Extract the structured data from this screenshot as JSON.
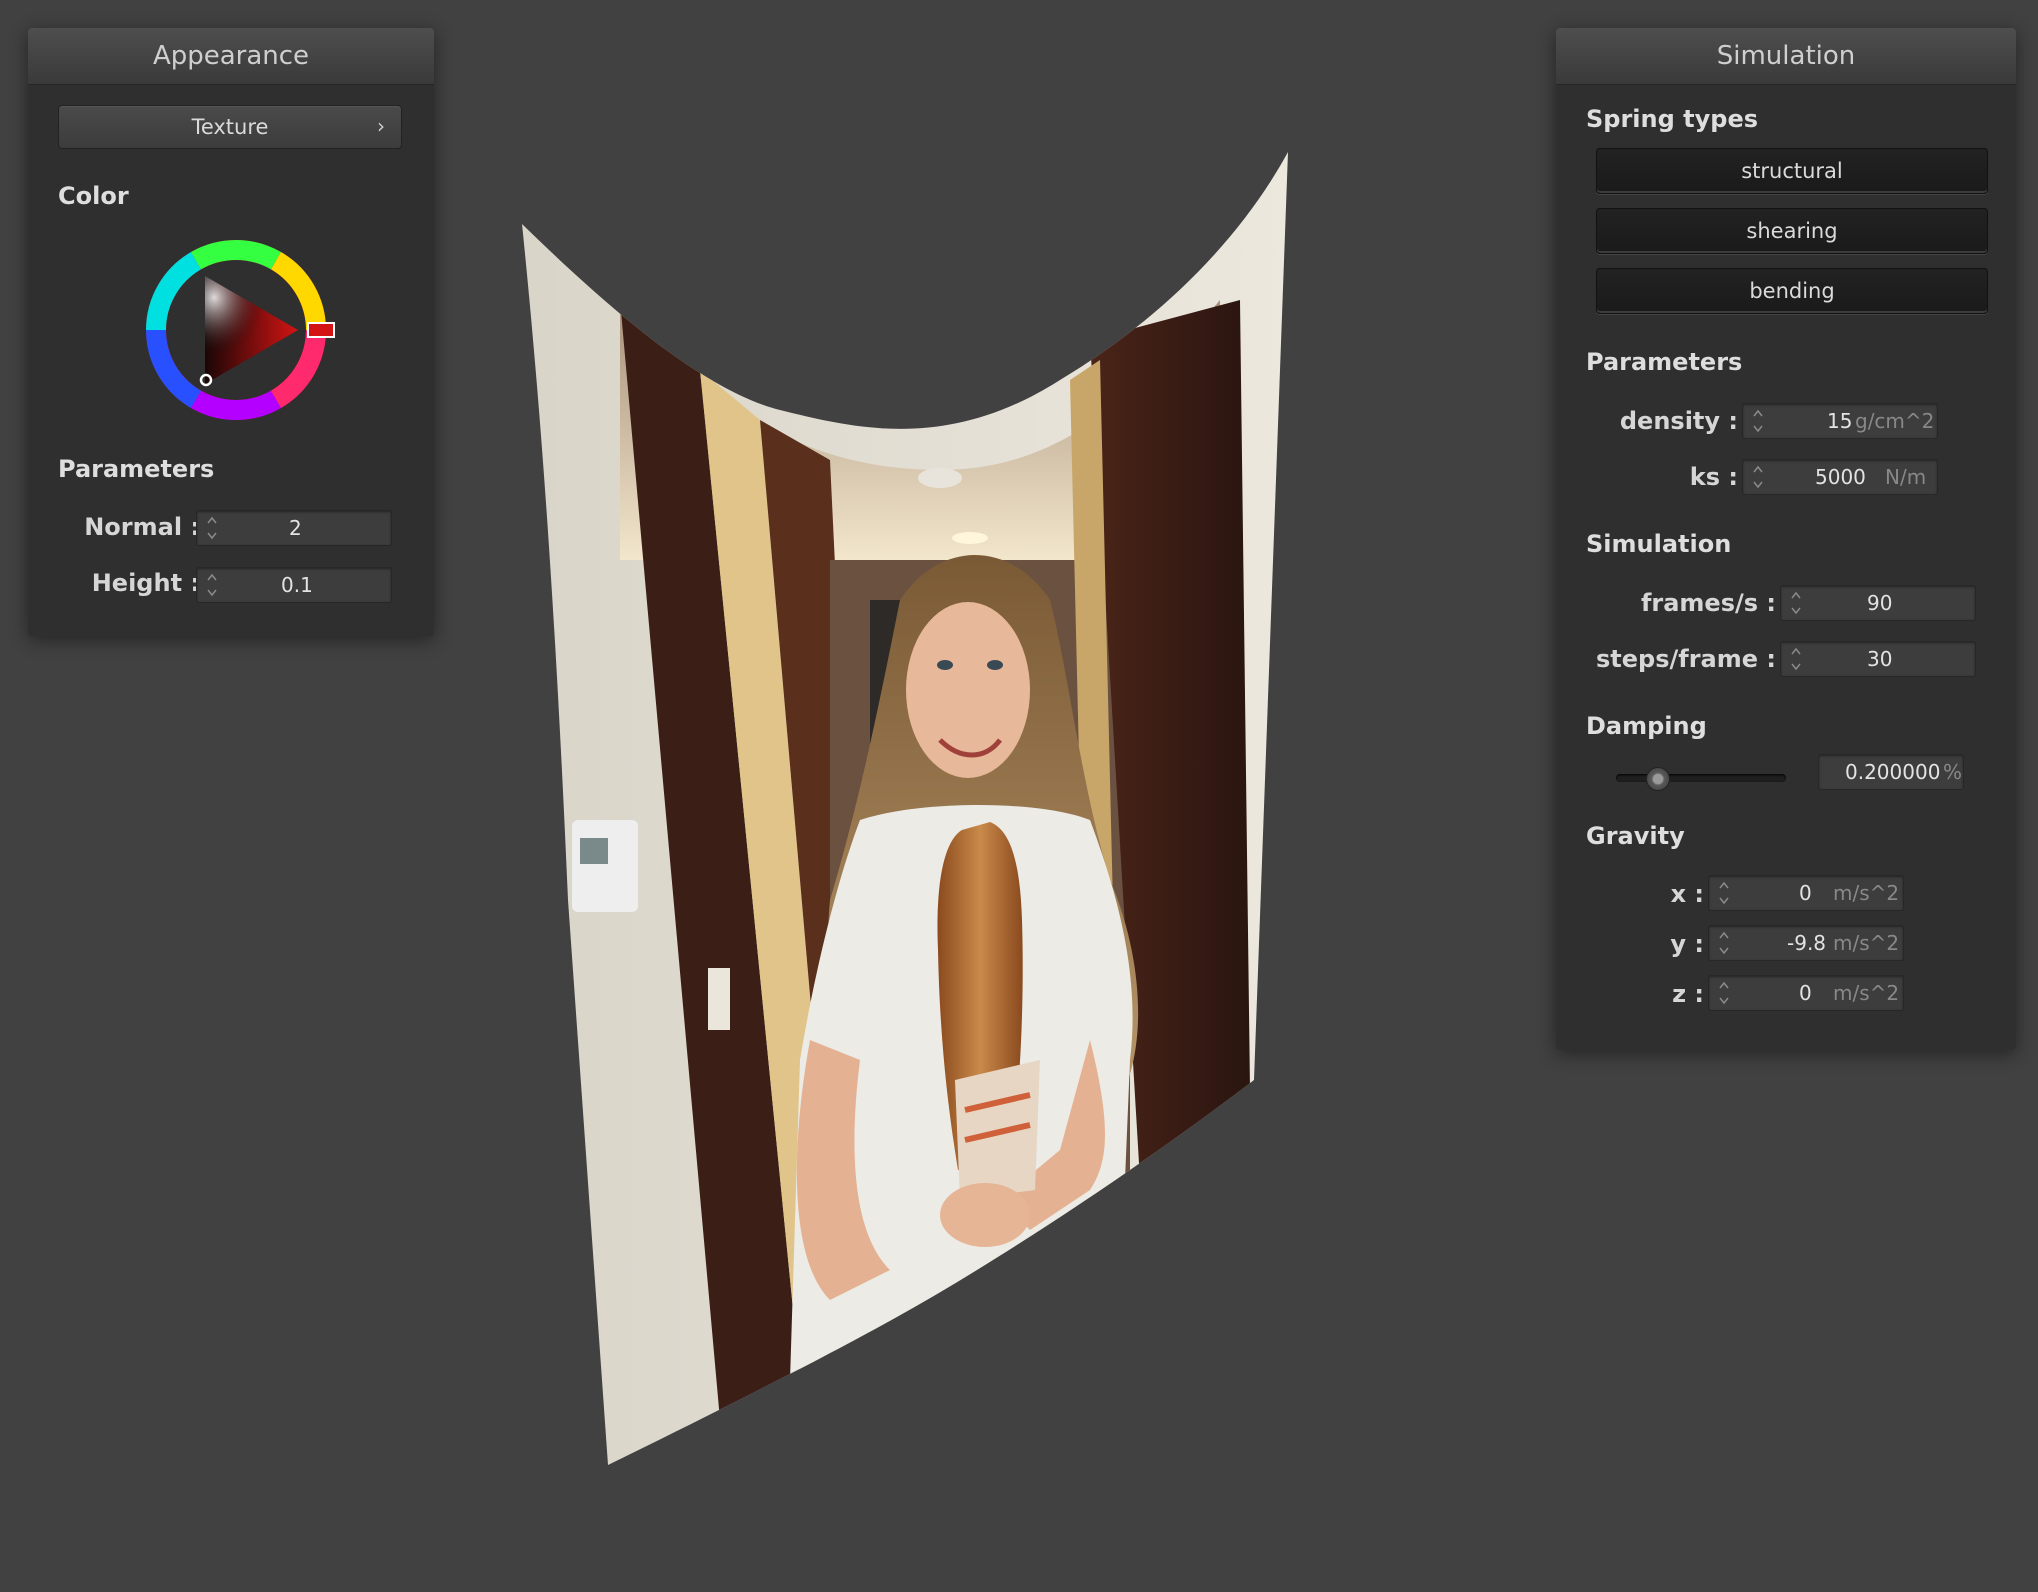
{
  "appearance": {
    "title": "Appearance",
    "texture_button": "Texture",
    "color_label": "Color",
    "parameters_label": "Parameters",
    "normal_label": "Normal :",
    "normal_value": "2",
    "height_label": "Height :",
    "height_value": "0.1"
  },
  "simulation": {
    "title": "Simulation",
    "spring_types_label": "Spring types",
    "spring_buttons": [
      "structural",
      "shearing",
      "bending"
    ],
    "parameters_label": "Parameters",
    "density_label": "density :",
    "density_value": "15",
    "density_unit": "g/cm^2",
    "ks_label": "ks :",
    "ks_value": "5000",
    "ks_unit": "N/m",
    "simulation_label": "Simulation",
    "fps_label": "frames/s :",
    "fps_value": "90",
    "steps_label": "steps/frame :",
    "steps_value": "30",
    "damping_label": "Damping",
    "damping_value": "0.200000",
    "damping_unit": "%",
    "damping_slider_level": 0.2,
    "gravity_label": "Gravity",
    "gx_label": "x :",
    "gx_value": "0",
    "gy_label": "y :",
    "gy_value": "-9.8",
    "gz_label": "z :",
    "gz_value": "0",
    "gravity_unit": "m/s^2"
  },
  "colors": {
    "background": "#414141",
    "panel": "#2f2f2f",
    "selected_color": "#cc1f1f"
  }
}
